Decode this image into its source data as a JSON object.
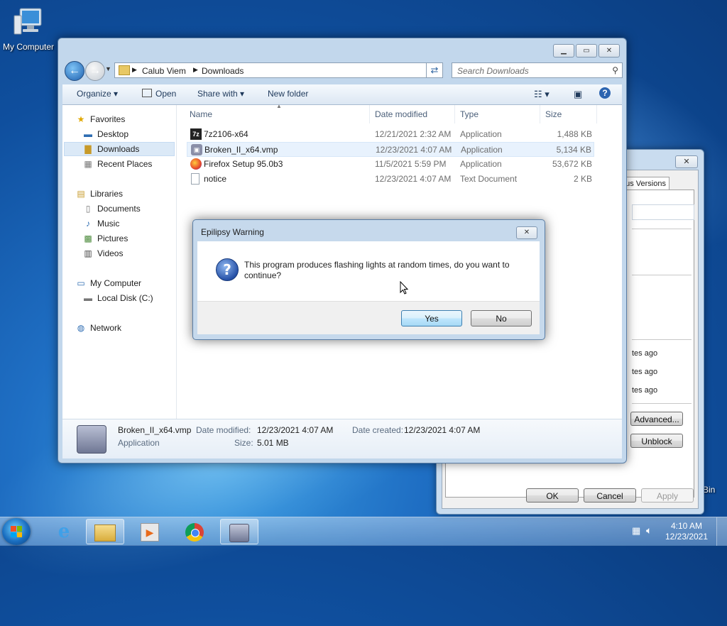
{
  "desktop": {
    "icon_label": "My Computer",
    "partial_label": "Bin"
  },
  "explorer": {
    "breadcrumb": [
      "Calub Viem",
      "Downloads"
    ],
    "search_placeholder": "Search Downloads",
    "toolbar": {
      "organize": "Organize",
      "open": "Open",
      "share_with": "Share with",
      "new_folder": "New folder"
    },
    "nav": {
      "favorites": "Favorites",
      "desktop": "Desktop",
      "downloads": "Downloads",
      "recent_places": "Recent Places",
      "libraries": "Libraries",
      "documents": "Documents",
      "music": "Music",
      "pictures": "Pictures",
      "videos": "Videos",
      "my_computer": "My Computer",
      "local_disk": "Local Disk (C:)",
      "network": "Network"
    },
    "columns": {
      "name": "Name",
      "date_modified": "Date modified",
      "type": "Type",
      "size": "Size"
    },
    "files": [
      {
        "name": "7z2106-x64",
        "date": "12/21/2021 2:32 AM",
        "type": "Application",
        "size": "1,488 KB",
        "icon": "7z-icon"
      },
      {
        "name": "Broken_II_x64.vmp",
        "date": "12/23/2021 4:07 AM",
        "type": "Application",
        "size": "5,134 KB",
        "icon": "vmp-icon"
      },
      {
        "name": "Firefox Setup 95.0b3",
        "date": "11/5/2021 5:59 PM",
        "type": "Application",
        "size": "53,672 KB",
        "icon": "firefox-icon"
      },
      {
        "name": "notice",
        "date": "12/23/2021 4:07 AM",
        "type": "Text Document",
        "size": "2 KB",
        "icon": "text-file-icon"
      }
    ],
    "details": {
      "name": "Broken_II_x64.vmp",
      "kind": "Application",
      "date_modified_label": "Date modified:",
      "date_modified": "12/23/2021 4:07 AM",
      "date_created_label": "Date created:",
      "date_created": "12/23/2021 4:07 AM",
      "size_label": "Size:",
      "size": "5.01 MB"
    }
  },
  "dialog": {
    "title": "Epilipsy Warning",
    "message": "This program produces flashing lights at random times, do you want to continue?",
    "yes": "Yes",
    "no": "No"
  },
  "properties": {
    "tab": "us Versions",
    "ago": [
      "tes ago",
      "tes ago",
      "tes ago"
    ],
    "advanced": "Advanced...",
    "unblock": "Unblock",
    "ok": "OK",
    "cancel": "Cancel",
    "apply": "Apply"
  },
  "taskbar": {
    "time": "4:10 AM",
    "date": "12/23/2021"
  }
}
